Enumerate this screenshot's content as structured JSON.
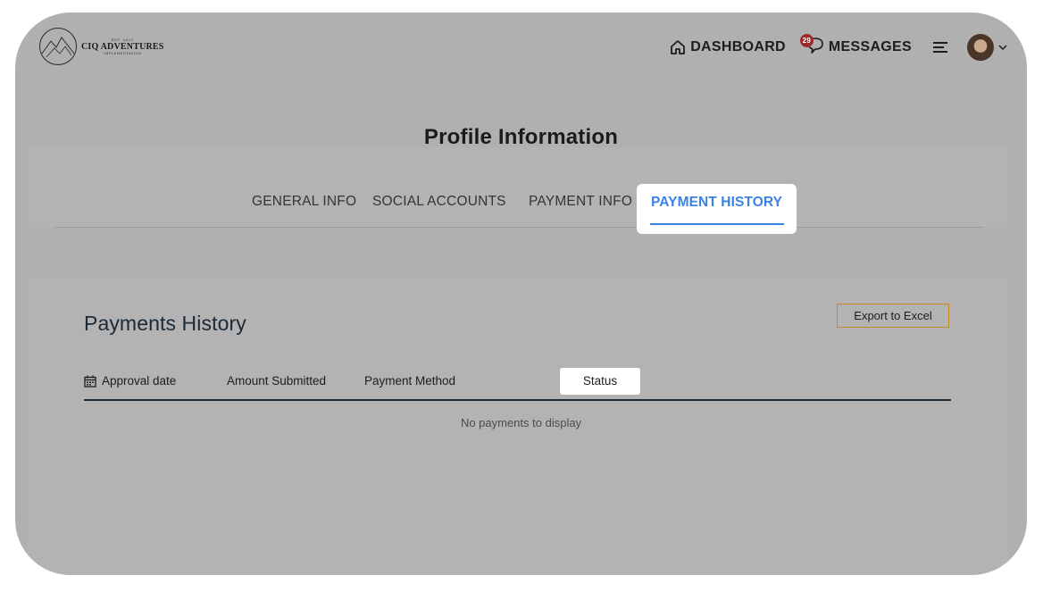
{
  "brand": {
    "est": "EST. 2021",
    "name": "CIQ ADVENTURES",
    "sub": "IMPLEMENTATION"
  },
  "nav": {
    "dashboard_label": "DASHBOARD",
    "messages_label": "MESSAGES",
    "messages_badge": "29",
    "icons": [
      "home-icon",
      "chat-bubble-icon",
      "hamburger-menu-icon",
      "chevron-down-icon"
    ]
  },
  "profile": {
    "title": "Profile Information",
    "tabs": [
      {
        "label": "GENERAL INFO",
        "active": false
      },
      {
        "label": "SOCIAL ACCOUNTS",
        "active": false
      },
      {
        "label": "PAYMENT INFO",
        "active": false
      },
      {
        "label": "PAYMENT HISTORY",
        "active": true
      }
    ]
  },
  "payments": {
    "title": "Payments History",
    "export_label": "Export to Excel",
    "columns": [
      {
        "label": "Approval date",
        "icon": "calendar-icon"
      },
      {
        "label": "Amount Submitted"
      },
      {
        "label": "Payment Method"
      },
      {
        "label": "Status"
      }
    ],
    "empty_message": "No payments to display"
  },
  "colors": {
    "overlay": "#b0b0b0",
    "accent": "#3b82e6",
    "export_border": "#c48a2a",
    "badge": "#9b2c2c"
  }
}
